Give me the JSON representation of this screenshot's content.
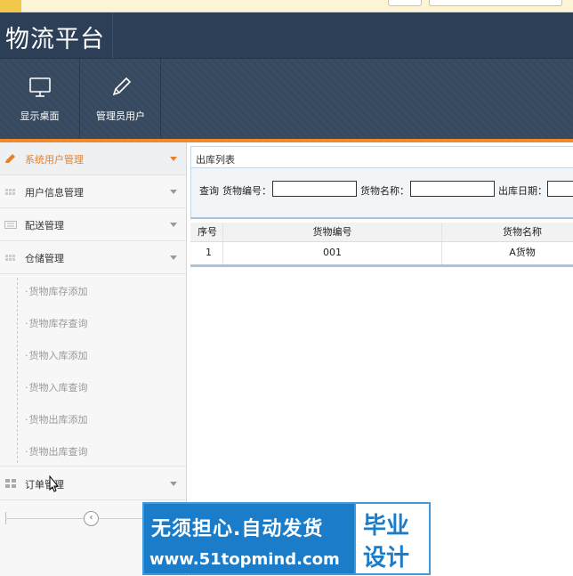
{
  "app": {
    "title": "物流平台"
  },
  "toolbar": {
    "items": [
      {
        "label": "显示桌面",
        "icon": "monitor-icon"
      },
      {
        "label": "管理员用户",
        "icon": "pencil-icon"
      }
    ]
  },
  "sidebar": {
    "items": [
      {
        "label": "系统用户管理",
        "icon": "pencil-icon",
        "active": true
      },
      {
        "label": "用户信息管理",
        "icon": "grid-icon"
      },
      {
        "label": "配送管理",
        "icon": "keyboard-icon"
      },
      {
        "label": "仓储管理",
        "icon": "grid-icon"
      }
    ],
    "subitems": [
      "货物库存添加",
      "货物库存查询",
      "货物入库添加",
      "货物入库查询",
      "货物出库添加",
      "货物出库查询"
    ],
    "order": {
      "label": "订单管理",
      "icon": "grid-icon"
    },
    "collapse": "‹"
  },
  "panel": {
    "title": "出库列表",
    "search": {
      "query_label": "查询",
      "code_label": "货物编号：",
      "code_value": "",
      "name_label": "货物名称：",
      "name_value": "",
      "date_label": "出库日期："
    }
  },
  "grid": {
    "columns": [
      "序号",
      "货物编号",
      "货物名称"
    ],
    "rows": [
      {
        "index": "1",
        "code": "001",
        "name": "A货物"
      }
    ]
  },
  "watermark": {
    "line1": "无须担心.自动发货",
    "line2": "www.51topmind.com",
    "side1": "毕业",
    "side2": "设计"
  },
  "colors": {
    "header": "#2c3f57",
    "toolbar": "#36495f",
    "accent": "#f08a2b",
    "active_text": "#e8802b",
    "watermark": "#1b7dc9"
  }
}
